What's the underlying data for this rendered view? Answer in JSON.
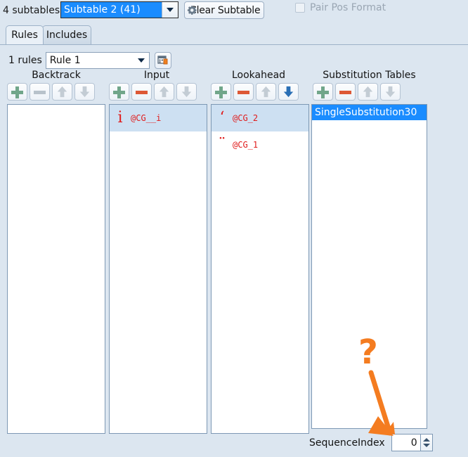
{
  "toolbar": {
    "subtables_count_label": "4 subtables",
    "subtable_combo_value": "Subtable 2 (41)",
    "clear_subtable_label": "Clear Subtable",
    "clear_subtable_icon": "gear-icon",
    "pair_pos_format_label": "Pair Pos Format",
    "pair_pos_format_checked": false
  },
  "tabs": [
    {
      "label": "Rules",
      "active": true
    },
    {
      "label": "Includes",
      "active": false
    }
  ],
  "rules": {
    "count_label": "1 rules",
    "combo_value": "Rule 1",
    "extra_button_icon": "table-properties-icon"
  },
  "columns": [
    {
      "title": "Backtrack",
      "buttons": [
        {
          "name": "add-backtrack-button",
          "icon": "plus-icon",
          "state": "enabled"
        },
        {
          "name": "remove-backtrack-button",
          "icon": "minus-icon",
          "state": "disabled"
        },
        {
          "name": "move-backtrack-up-button",
          "icon": "arrow-up-icon",
          "state": "disabled"
        },
        {
          "name": "move-backtrack-down-button",
          "icon": "arrow-down-icon",
          "state": "disabled"
        }
      ],
      "items": []
    },
    {
      "title": "Input",
      "buttons": [
        {
          "name": "add-input-button",
          "icon": "plus-icon",
          "state": "enabled"
        },
        {
          "name": "remove-input-button",
          "icon": "minus-icon",
          "state": "enabled"
        },
        {
          "name": "move-input-up-button",
          "icon": "arrow-up-icon",
          "state": "disabled"
        },
        {
          "name": "move-input-down-button",
          "icon": "arrow-down-icon",
          "state": "disabled"
        }
      ],
      "items": [
        {
          "glyph": "i",
          "name": "@CG__i",
          "selected": true
        }
      ]
    },
    {
      "title": "Lookahead",
      "buttons": [
        {
          "name": "add-lookahead-button",
          "icon": "plus-icon",
          "state": "enabled"
        },
        {
          "name": "remove-lookahead-button",
          "icon": "minus-icon",
          "state": "enabled"
        },
        {
          "name": "move-lookahead-up-button",
          "icon": "arrow-up-icon",
          "state": "disabled"
        },
        {
          "name": "move-lookahead-down-button",
          "icon": "arrow-down-icon",
          "state": "active"
        }
      ],
      "items": [
        {
          "glyph": "ʻ",
          "name": "@CG_2",
          "selected": true
        },
        {
          "glyph": "¨",
          "name": "@CG_1",
          "selected": false
        }
      ]
    },
    {
      "title": "Substitution Tables",
      "buttons": [
        {
          "name": "add-substitution-button",
          "icon": "plus-icon",
          "state": "enabled"
        },
        {
          "name": "remove-substitution-button",
          "icon": "minus-icon",
          "state": "enabled"
        },
        {
          "name": "move-substitution-up-button",
          "icon": "arrow-up-icon",
          "state": "disabled"
        },
        {
          "name": "move-substitution-down-button",
          "icon": "arrow-down-icon",
          "state": "disabled"
        }
      ],
      "items": [
        {
          "label": "SingleSubstitution30",
          "selected": true
        }
      ]
    }
  ],
  "sequence_index": {
    "label": "SequenceIndex",
    "value": "0"
  },
  "annotation": {
    "question_mark": "?",
    "arrow_color": "#f47c20"
  },
  "colors": {
    "background": "#dce6f0",
    "selection_blue": "#1a8cff",
    "row_selection": "#cde0f2",
    "glyph_red": "#e01b1b",
    "plus_green": "#71a68a",
    "minus_red": "#dd5836",
    "arrow_active_blue": "#2a6fb5",
    "annotation_orange": "#f47c20"
  }
}
